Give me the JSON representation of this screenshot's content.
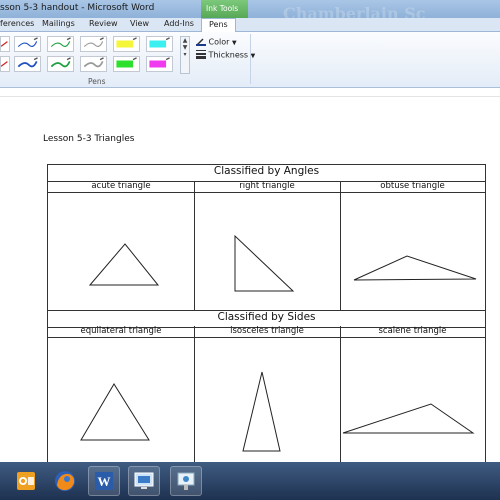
{
  "window": {
    "title": "sson 5-3 handout  -  Microsoft Word",
    "watermark": "Chamberlain Sc",
    "contextual_tab_group": "Ink Tools"
  },
  "ribbon": {
    "tabs": [
      {
        "label": "ferences"
      },
      {
        "label": "Mailings"
      },
      {
        "label": "Review"
      },
      {
        "label": "View"
      },
      {
        "label": "Add-Ins"
      },
      {
        "label": "Pens"
      }
    ],
    "pens_row1": [
      {
        "icon": "red-pen-icon",
        "color": "#d02020"
      },
      {
        "icon": "blue-pen-icon",
        "color": "#2050c0"
      },
      {
        "icon": "green-pen-icon",
        "color": "#20a040"
      },
      {
        "icon": "gray-pen-icon",
        "color": "#9a9a9a"
      },
      {
        "icon": "yellow-highlighter-icon",
        "color": "#f5f53a"
      },
      {
        "icon": "cyan-highlighter-icon",
        "color": "#3af0f0"
      }
    ],
    "pens_row2": [
      {
        "icon": "red-pen-icon",
        "color": "#d02020"
      },
      {
        "icon": "blue-pen-icon",
        "color": "#2050c0"
      },
      {
        "icon": "green-pen-icon",
        "color": "#20a040"
      },
      {
        "icon": "gray-pen-icon",
        "color": "#9a9a9a"
      },
      {
        "icon": "green-highlighter-icon",
        "color": "#2ee02e"
      },
      {
        "icon": "magenta-highlighter-icon",
        "color": "#f03af0"
      }
    ],
    "pens_group_label": "Pens",
    "color_label": "Color",
    "thickness_label": "Thickness"
  },
  "document": {
    "heading": "Lesson 5-3 Triangles",
    "sections": [
      {
        "title": "Classified by Angles",
        "columns": [
          "acute triangle",
          "right triangle",
          "obtuse triangle"
        ]
      },
      {
        "title": "Classified by Sides",
        "columns": [
          "equilateral triangle",
          "isosceles triangle",
          "scalene triangle"
        ]
      }
    ]
  },
  "taskbar": {
    "apps": [
      {
        "icon": "outlook-icon"
      },
      {
        "icon": "firefox-icon"
      },
      {
        "icon": "word-icon"
      },
      {
        "icon": "remote-desktop-icon"
      },
      {
        "icon": "presentation-app-icon"
      }
    ]
  },
  "colors": {
    "titlebar": "#9dbde2",
    "contextual": "#5cb85c",
    "taskbar": "#2a4368"
  }
}
